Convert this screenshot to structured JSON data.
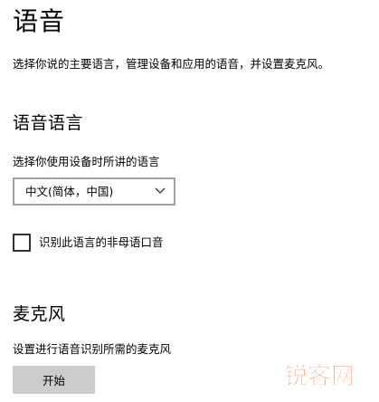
{
  "page": {
    "title": "语音",
    "description": "选择你说的主要语言，管理设备和应用的语音，并设置麦克风。"
  },
  "speech_language": {
    "heading": "语音语言",
    "label": "选择你使用设备时所讲的语言",
    "selected": "中文(简体，中国)",
    "nonnative_checkbox": {
      "label": "识别此语言的非母语口音",
      "checked": false
    }
  },
  "microphone": {
    "heading": "麦克风",
    "label": "设置进行语音识别所需的麦克风",
    "button_label": "开始"
  },
  "watermark": {
    "text": "锐客网",
    "color": "#e8540f"
  }
}
